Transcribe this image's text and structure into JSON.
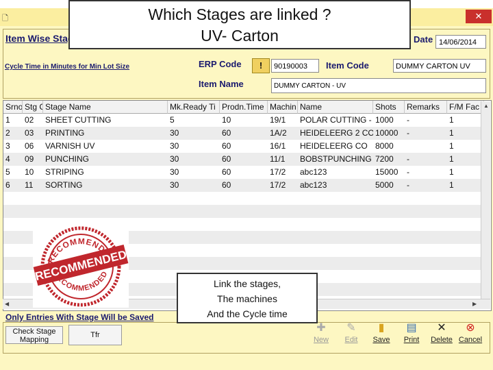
{
  "callout_top": {
    "line1": "Which Stages are linked ?",
    "line2": "UV- Carton"
  },
  "callout_mid": {
    "line1": "Link the stages,",
    "line2": "The machines",
    "line3": "And the Cycle time"
  },
  "window": {
    "close_glyph": "✕",
    "icon": "window-icon"
  },
  "header": {
    "title": "Item Wise Stag",
    "date_label": "Date",
    "date_value": "14/06/2014",
    "cycle_label": "Cycle Time in Minutes for Min Lot Size",
    "erp_label": "ERP Code",
    "warn_glyph": "!",
    "erp_value": "90190003",
    "item_code_label": "Item Code",
    "item_code_value": "DUMMY CARTON   UV",
    "item_name_label": "Item Name",
    "item_name_value": "DUMMY CARTON - UV"
  },
  "grid": {
    "columns": [
      "Srno",
      "Stg C",
      "Stage Name",
      "Mk.Ready Ti",
      "Prodn.Time",
      "Machin",
      "Name",
      "Shots",
      "Remarks",
      "F/M Fac"
    ],
    "rows": [
      [
        "1",
        "02",
        "SHEET CUTTING",
        "5",
        "10",
        "19/1",
        "POLAR CUTTING -",
        "1000",
        "-",
        "1"
      ],
      [
        "2",
        "03",
        "PRINTING",
        "30",
        "60",
        "1A/2",
        "HEIDELEERG 2 CO",
        "10000",
        "-",
        "1"
      ],
      [
        "3",
        "06",
        "VARNISH   UV",
        "30",
        "60",
        "16/1",
        "HEIDELEERG CO",
        "8000",
        "",
        "1"
      ],
      [
        "4",
        "09",
        "PUNCHING",
        "30",
        "60",
        "11/1",
        "BOBSTPUNCHING",
        "7200",
        "-",
        "1"
      ],
      [
        "5",
        "10",
        "STRIPING",
        "30",
        "60",
        "17/2",
        "abc123",
        "15000",
        "-",
        "1"
      ],
      [
        "6",
        "11",
        "SORTING",
        "30",
        "60",
        "17/2",
        "abc123",
        "5000",
        "-",
        "1"
      ]
    ]
  },
  "stamp": {
    "top_text": "RECOMMENDED",
    "band_text": "RECOMMENDED",
    "bottom_text": "RECOMMENDED",
    "color": "#c0272d"
  },
  "footer": {
    "notice": "Only Entries With Stage Will be Saved",
    "check_button": "Check Stage Mapping",
    "tfr_button": "Tfr",
    "tools": [
      {
        "label": "New",
        "icon": "new-icon",
        "enabled": false
      },
      {
        "label": "Edit",
        "icon": "edit-icon",
        "enabled": false
      },
      {
        "label": "Save",
        "icon": "save-icon",
        "enabled": true
      },
      {
        "label": "Print",
        "icon": "print-icon",
        "enabled": true
      },
      {
        "label": "Delete",
        "icon": "delete-icon",
        "enabled": true
      },
      {
        "label": "Cancel",
        "icon": "cancel-icon",
        "enabled": true
      }
    ]
  }
}
